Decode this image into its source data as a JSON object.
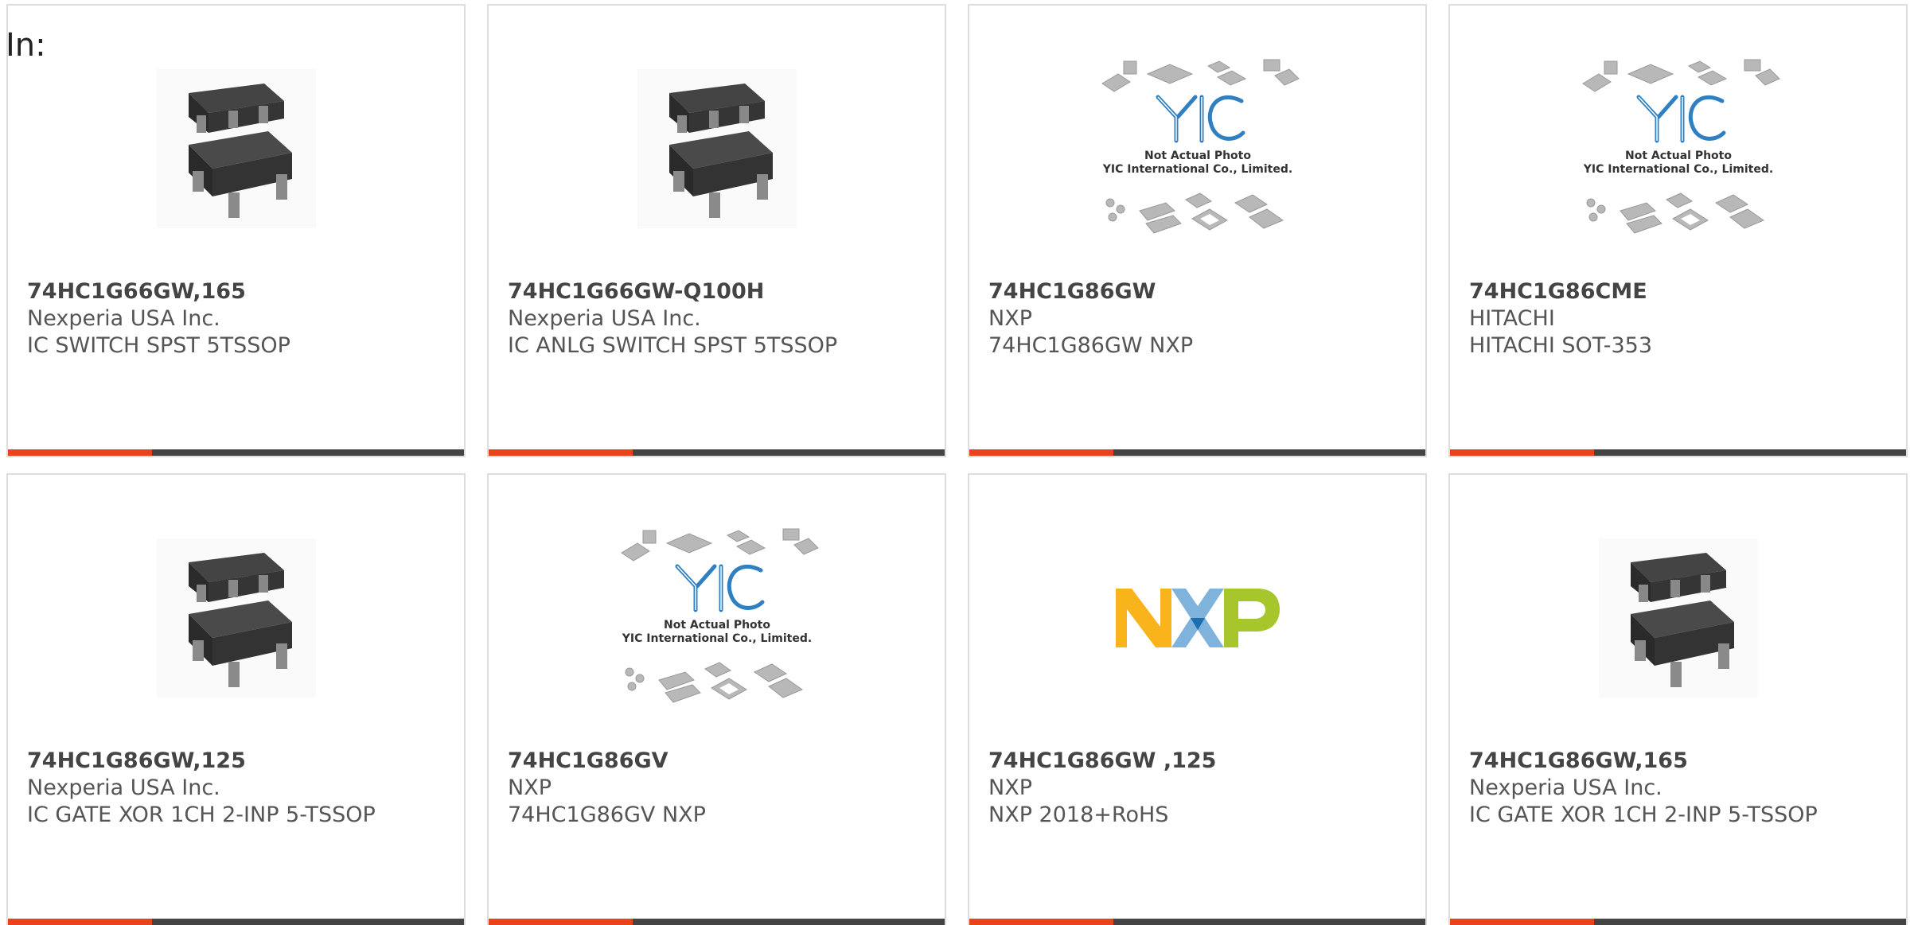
{
  "header": {
    "label": "In:"
  },
  "colors": {
    "accent": "#e8431a",
    "bar": "#444444",
    "border": "#dddddd"
  },
  "products": [
    {
      "part_number": "74HC1G66GW,165",
      "manufacturer": "Nexperia USA Inc.",
      "description": "IC SWITCH SPST 5TSSOP",
      "image": "chip-package-icon"
    },
    {
      "part_number": "74HC1G66GW-Q100H",
      "manufacturer": "Nexperia USA Inc.",
      "description": "IC ANLG SWITCH SPST 5TSSOP",
      "image": "chip-package-icon"
    },
    {
      "part_number": "74HC1G86GW",
      "manufacturer": "NXP",
      "description": "74HC1G86GW NXP",
      "image": "placeholder-photo",
      "placeholder_line1": "Not Actual Photo",
      "placeholder_line2": "YIC International Co., Limited."
    },
    {
      "part_number": "74HC1G86CME",
      "manufacturer": "HITACHI",
      "description": "HITACHI SOT-353",
      "image": "placeholder-photo",
      "placeholder_line1": "Not Actual Photo",
      "placeholder_line2": "YIC International Co., Limited."
    },
    {
      "part_number": "74HC1G86GW,125",
      "manufacturer": "Nexperia USA Inc.",
      "description": "IC GATE XOR 1CH 2-INP 5-TSSOP",
      "image": "chip-package-icon"
    },
    {
      "part_number": "74HC1G86GV",
      "manufacturer": "NXP",
      "description": "74HC1G86GV NXP",
      "image": "placeholder-photo",
      "placeholder_line1": "Not Actual Photo",
      "placeholder_line2": "YIC International Co., Limited."
    },
    {
      "part_number": "74HC1G86GW ,125",
      "manufacturer": "NXP",
      "description": "NXP 2018+RoHS",
      "image": "nxp-logo"
    },
    {
      "part_number": "74HC1G86GW,165",
      "manufacturer": "Nexperia USA Inc.",
      "description": "IC GATE XOR 1CH 2-INP 5-TSSOP",
      "image": "chip-package-icon"
    }
  ]
}
